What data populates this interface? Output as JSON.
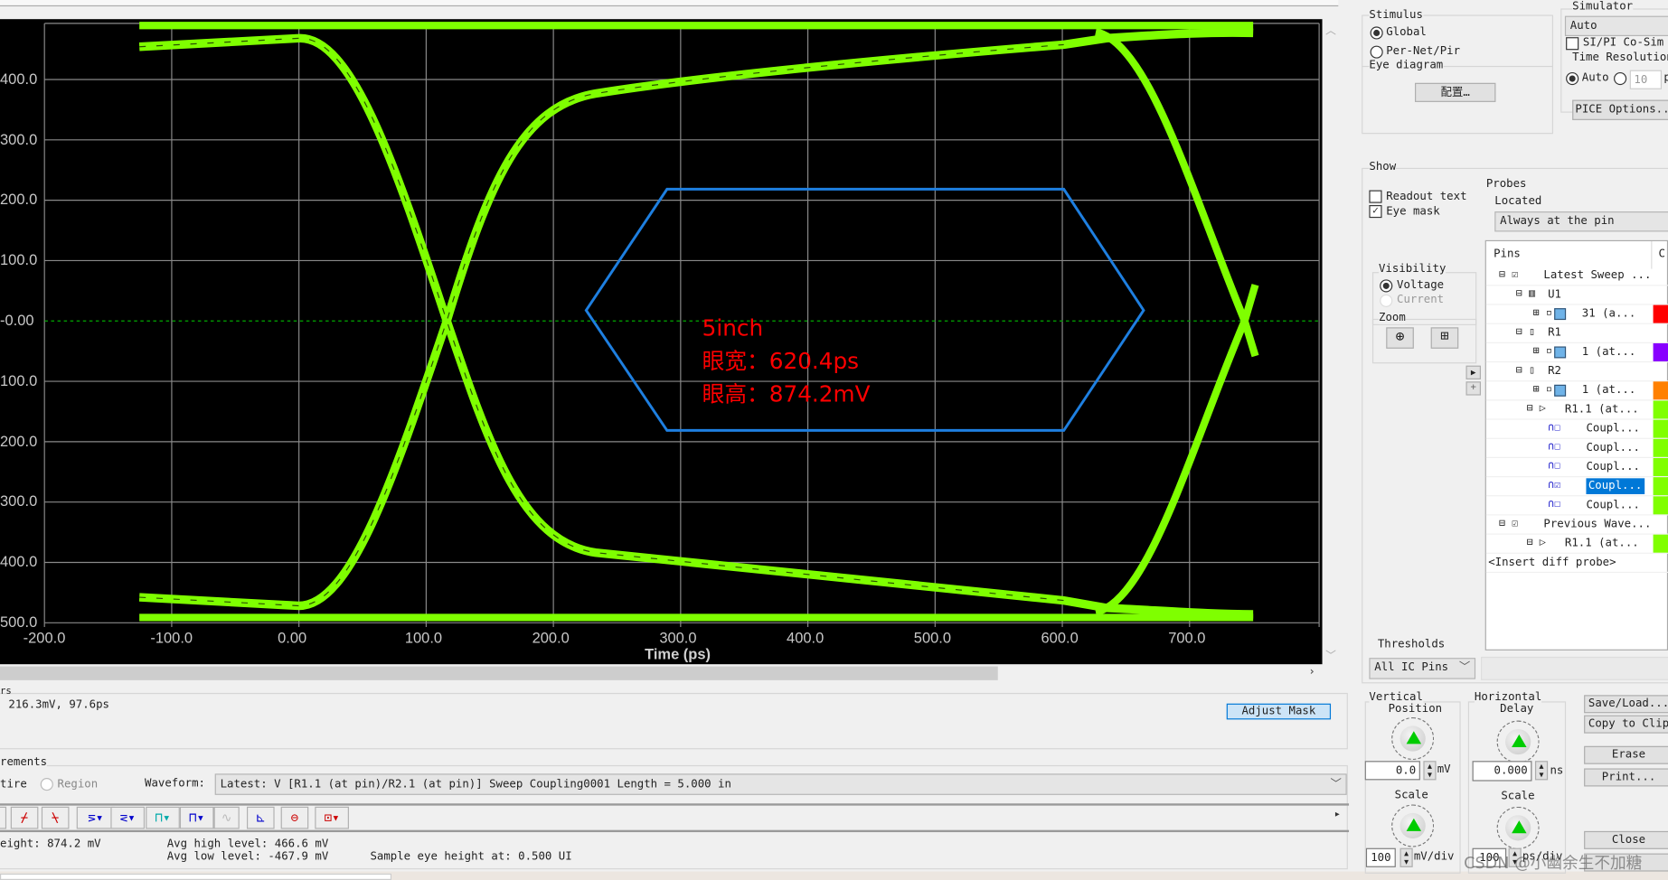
{
  "plot": {
    "y_ticks": [
      "400.0",
      "300.0",
      "200.0",
      "100.0",
      "-0.00",
      "100.0",
      "200.0",
      "300.0",
      "400.0",
      "500.0"
    ],
    "x_ticks": [
      "-200.0",
      "-100.0",
      "0.00",
      "100.0",
      "200.0",
      "300.0",
      "400.0",
      "500.0",
      "600.0",
      "700.0"
    ],
    "x_label": "Time (ps)",
    "annotation": [
      "5inch",
      "眼宽：620.4ps",
      "眼高：874.2mV"
    ],
    "colors": {
      "background": "#000000",
      "trace": "#7fff00",
      "mask": "#1e7fe0",
      "annotation": "#ff0000"
    }
  },
  "stimulus": {
    "title": "Stimulus",
    "global": "Global",
    "per_net": "Per-Net/Pir",
    "eye_title": "Eye diagram",
    "config_button": "配置…"
  },
  "simulator": {
    "title": "Simulator",
    "select": "Auto",
    "sipi": "SI/PI Co-Sim",
    "time_res": "Time Resolution",
    "auto": "Auto",
    "value": "10",
    "unit": "p",
    "pice_button": "PICE Options.."
  },
  "show": {
    "title": "Show",
    "readout": "Readout text",
    "eye_mask": "Eye mask",
    "probes": "Probes",
    "located": "Located",
    "located_select": "Always at the pin",
    "visibility": "Visibility",
    "voltage": "Voltage",
    "current": "Current",
    "zoom": "Zoom"
  },
  "pins": {
    "header": "Pins",
    "col2": "C",
    "rows": [
      "Latest Sweep ...",
      "U1",
      "31 (a...",
      "R1",
      "1 (at...",
      "R2",
      "1 (at...",
      "R1.1 (at...",
      "Coupl...",
      "Coupl...",
      "Coupl...",
      "Coupl...",
      "Coupl...",
      "Previous Wave...",
      "R1.1 (at...",
      "<Insert diff probe>"
    ],
    "swatch_colors": {
      "red": "#ff0000",
      "purple": "#8800ff",
      "orange": "#ff8000",
      "green": "#80ff00"
    }
  },
  "thresholds": {
    "title": "Thresholds",
    "select": "All IC Pins"
  },
  "vertical": {
    "title1": "Vertical",
    "title2": "Position",
    "value": "0.0",
    "unit": "mV",
    "scale": "Scale",
    "scale_value": "100",
    "scale_unit": "mV/div"
  },
  "horizontal": {
    "title1": "Horizontal",
    "title2": "Delay",
    "value": "0.000",
    "unit": "ns",
    "scale": "Scale",
    "scale_value": "100",
    "scale_unit": "ps/div"
  },
  "buttons": {
    "save_load": "Save/Load...",
    "copy": "Copy to Clip",
    "erase": "Erase",
    "print": "Print...",
    "close": "Close"
  },
  "cursors": {
    "title": "rs",
    "value": "216.3mV, 97.6ps",
    "adjust_mask": "Adjust Mask"
  },
  "measurements": {
    "title": "rements",
    "entire": "tire",
    "region": "Region",
    "waveform_label": "Waveform:",
    "waveform": "Latest: V [R1.1 (at pin)/R2.1 (at pin)] Sweep Coupling0001 Length = 5.000 in"
  },
  "results": {
    "eye_height": "eight: 874.2 mV",
    "avg_high": "Avg high level: 466.6 mV",
    "avg_low": "Avg low level: -467.9 mV",
    "sample": "Sample eye height at: 0.500 UI"
  },
  "watermark": "CSDN @小幽余生不加糖"
}
